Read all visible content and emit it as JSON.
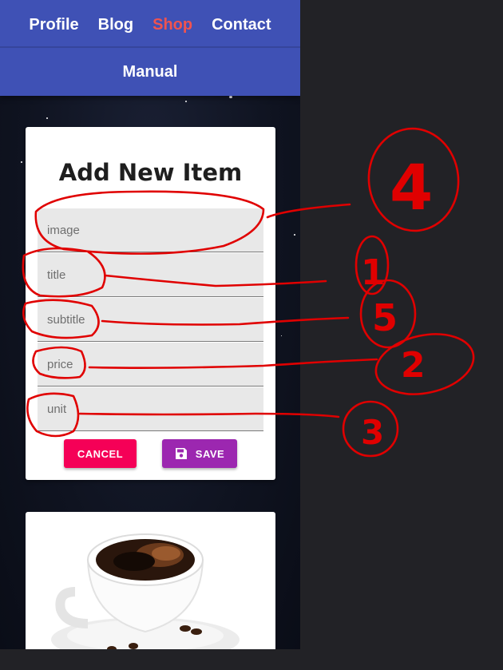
{
  "nav": {
    "links": [
      {
        "label": "Profile",
        "active": false
      },
      {
        "label": "Blog",
        "active": false
      },
      {
        "label": "Shop",
        "active": true
      },
      {
        "label": "Contact",
        "active": false
      }
    ],
    "manual_label": "Manual"
  },
  "form": {
    "title": "Add New Item",
    "fields": [
      {
        "name": "image",
        "placeholder": "image"
      },
      {
        "name": "title",
        "placeholder": "title"
      },
      {
        "name": "subtitle",
        "placeholder": "subtitle"
      },
      {
        "name": "price",
        "placeholder": "price"
      },
      {
        "name": "unit",
        "placeholder": "unit"
      }
    ],
    "cancel_label": "CANCEL",
    "save_label": "SAVE"
  },
  "product_card": {
    "image_icon": "coffee-cup-icon"
  },
  "annotations": {
    "numbers": [
      "4",
      "1",
      "5",
      "2",
      "3"
    ],
    "color": "#e00000"
  },
  "colors": {
    "nav_bg": "#3f51b5",
    "nav_active": "#ef5350",
    "cancel_bg": "#f50057",
    "save_bg": "#9c27b0",
    "outer_bg": "#222226"
  }
}
